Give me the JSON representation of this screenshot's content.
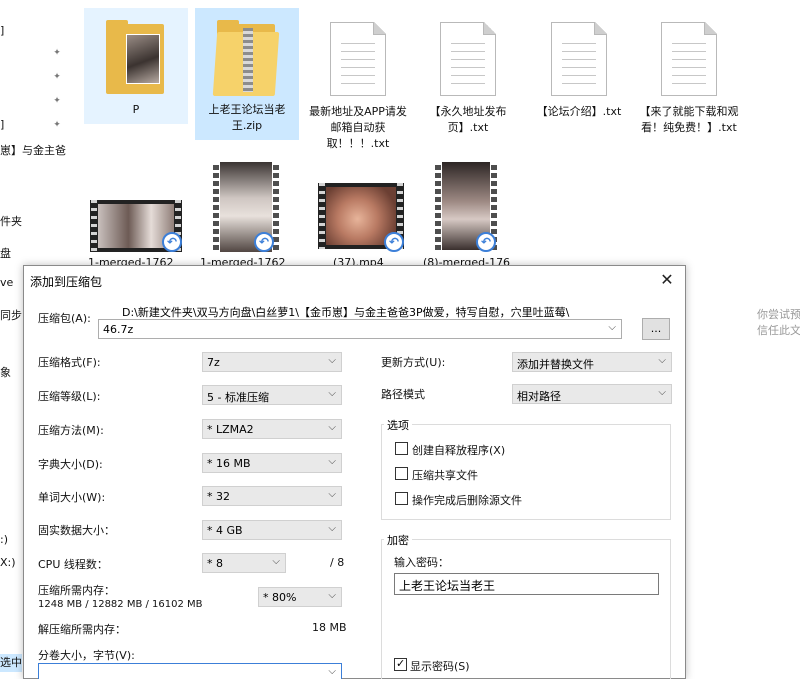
{
  "explorer": {
    "nav_fragments": [
      "]",
      "]",
      "崽】与金主爸",
      "件夹",
      "盘",
      "ve",
      "同步",
      "象",
      ":)",
      "X:)",
      "选中"
    ],
    "files": [
      {
        "label": "P",
        "kind": "folder"
      },
      {
        "label": "上老王论坛当老王.zip",
        "kind": "zip"
      },
      {
        "label": "最新地址及APP请发邮箱自动获取！！！.txt",
        "kind": "txt"
      },
      {
        "label": "【永久地址发布页】.txt",
        "kind": "txt"
      },
      {
        "label": "【论坛介绍】.txt",
        "kind": "txt"
      },
      {
        "label": "【来了就能下载和观看！纯免费！】.txt",
        "kind": "txt"
      }
    ],
    "videos": [
      {
        "label": "1-merged-1762"
      },
      {
        "label": "1-merged-1762"
      },
      {
        "label": "(37).mp4"
      },
      {
        "label": "(8)-merged-176"
      }
    ],
    "right_hint": [
      "你尝试预",
      "信任此文"
    ]
  },
  "dialog": {
    "title": "添加到压缩包",
    "close_icon": "close-icon",
    "archive_label": "压缩包(A):",
    "archive_path": "D:\\新建文件夹\\双马方向盘\\白丝萝1\\【金币崽】与金主爸爸3P做爱，特写自慰，穴里吐蓝莓\\",
    "archive_name": "46.7z",
    "browse_button": "...",
    "format_label": "压缩格式(F):",
    "format_value": "7z",
    "level_label": "压缩等级(L):",
    "level_value": "5 - 标准压缩",
    "method_label": "压缩方法(M):",
    "method_value": "* LZMA2",
    "dict_label": "字典大小(D):",
    "dict_value": "* 16 MB",
    "word_label": "单词大小(W):",
    "word_value": "* 32",
    "solid_label": "固实数据大小：",
    "solid_value": "* 4 GB",
    "cpu_label": "CPU 线程数：",
    "cpu_value": "* 8",
    "cpu_total": "/ 8",
    "mem_label": "压缩所需内存：",
    "mem_detail": "1248 MB / 12882 MB / 16102 MB",
    "mem_value": "* 80%",
    "decomp_label": "解压缩所需内存：",
    "decomp_value": "18 MB",
    "split_label": "分卷大小，字节(V):",
    "split_value": "",
    "update_label": "更新方式(U):",
    "update_value": "添加并替换文件",
    "pathmode_label": "路径模式",
    "pathmode_value": "相对路径",
    "options_title": "选项",
    "opt_sfx": "创建自释放程序(X)",
    "opt_shared": "压缩共享文件",
    "opt_delete": "操作完成后删除源文件",
    "encrypt_title": "加密",
    "password_label": "输入密码：",
    "password_value": "上老王论坛当老王",
    "show_password": "显示密码(S)"
  }
}
